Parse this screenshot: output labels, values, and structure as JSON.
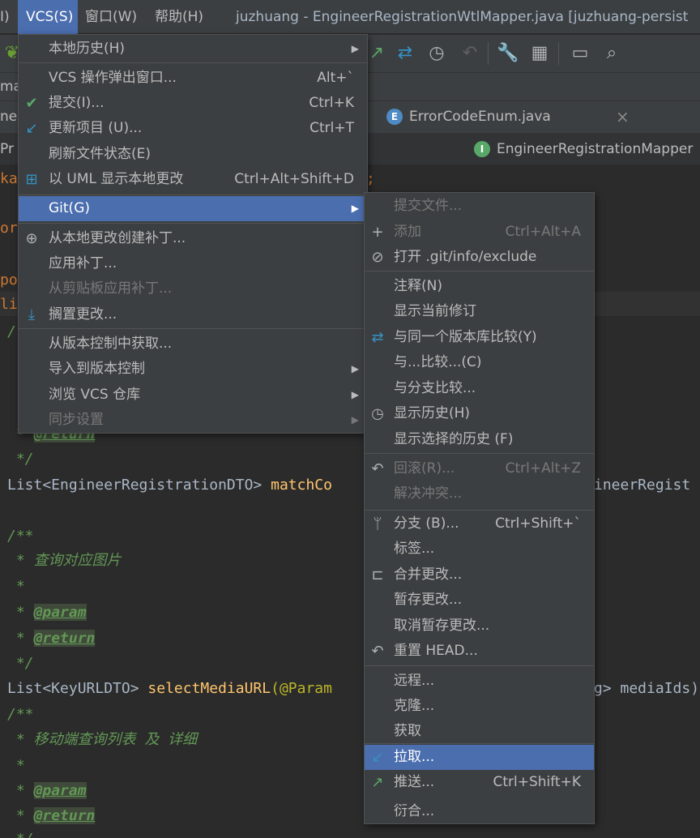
{
  "menubar": {
    "item_partial": "I)",
    "vcs": "VCS(S)",
    "window": "窗口(W)",
    "help": "帮助(H)",
    "title": "juzhuang - EngineerRegistrationWtlMapper.java [juzhuang-persist"
  },
  "navbar": {
    "crumb": "ma"
  },
  "tabs": {
    "left_partial": "ne",
    "active": "ErrorCodeEnum.java",
    "close": "×",
    "active_badge": "E"
  },
  "breadcrumb": {
    "left_partial": "Pr",
    "right": "EngineerRegistrationMapper",
    "right_badge": "I"
  },
  "code": {
    "l1": "ka",
    "l1b": ";",
    "l2": "or",
    "l3": "po",
    "l4": "li",
    "l5": "/",
    "l6": " * ",
    "l6tag": "@return",
    "l7": " */",
    "l8a": "List<EngineerRegistrationDTO> ",
    "l8b": "matchCo",
    "l8c": "ineerRegist",
    "l9": "/**",
    "l10": " * 查询对应图片",
    "l11": " *",
    "l12tag": "@param",
    "l13tag": "@return",
    "l14": " */",
    "l15a": "List<KeyURLDTO> ",
    "l15b": "selectMediaURL",
    "l15c": "(@Param",
    "l15d": "g> mediaIds)",
    "l16": "/**",
    "l17": " * 移动端查询列表 及 详细",
    "l18": " *",
    "l19tag": "@param",
    "l20tag": "@return",
    "l21": " */"
  },
  "vcs_menu": [
    {
      "label": "本地历史(H)",
      "arrow": "▶"
    },
    {
      "label": "VCS 操作弹出窗口...",
      "shortcut": "Alt+`"
    },
    {
      "label": "提交(I)...",
      "shortcut": "Ctrl+K",
      "icon": "✔"
    },
    {
      "label": "更新项目 (U)...",
      "shortcut": "Ctrl+T",
      "icon": "↙"
    },
    {
      "label": "刷新文件状态(E)"
    },
    {
      "label": "以 UML 显示本地更改",
      "shortcut": "Ctrl+Alt+Shift+D",
      "icon": "⊞"
    },
    {
      "label": "Git(G)",
      "arrow": "▶"
    },
    {
      "label": "从本地更改创建补丁...",
      "icon": "⊕"
    },
    {
      "label": "应用补丁..."
    },
    {
      "label": "从剪贴板应用补丁..."
    },
    {
      "label": "搁置更改...",
      "icon": "⤓"
    },
    {
      "label": "从版本控制中获取..."
    },
    {
      "label": "导入到版本控制",
      "arrow": "▶"
    },
    {
      "label": "浏览 VCS 仓库",
      "arrow": "▶"
    },
    {
      "label": "同步设置",
      "arrow": "▶"
    }
  ],
  "git_menu": [
    {
      "label": "提交文件..."
    },
    {
      "label": "添加",
      "shortcut": "Ctrl+Alt+A",
      "icon": "+"
    },
    {
      "label": "打开 .git/info/exclude",
      "icon": "⊘"
    },
    {
      "label": "注释(N)"
    },
    {
      "label": "显示当前修订"
    },
    {
      "label": "与同一个版本库比较(Y)",
      "icon": "⇄"
    },
    {
      "label": "与...比较...(C)"
    },
    {
      "label": "与分支比较..."
    },
    {
      "label": "显示历史(H)",
      "icon": "◷"
    },
    {
      "label": "显示选择的历史 (F)"
    },
    {
      "label": "回滚(R)...",
      "shortcut": "Ctrl+Alt+Z",
      "icon": "↶"
    },
    {
      "label": "解决冲突..."
    },
    {
      "label": "分支 (B)...",
      "shortcut": "Ctrl+Shift+`",
      "icon": "ᛘ"
    },
    {
      "label": "标签..."
    },
    {
      "label": "合并更改...",
      "icon": "⊏"
    },
    {
      "label": "暂存更改..."
    },
    {
      "label": "取消暂存更改..."
    },
    {
      "label": "重置 HEAD...",
      "icon": "↶"
    },
    {
      "label": "远程..."
    },
    {
      "label": "克隆..."
    },
    {
      "label": "获取"
    },
    {
      "label": "拉取...",
      "icon": "↙"
    },
    {
      "label": "推送...",
      "shortcut": "Ctrl+Shift+K",
      "icon": "↗"
    },
    {
      "label": "衍合..."
    }
  ],
  "toolbar_icons": {
    "push": "↗",
    "compare": "⇄",
    "history": "◷",
    "rollback": "↶",
    "settings": "🔧",
    "structure": "▦",
    "terminal": "▭",
    "search": "⌕",
    "leaf": "❦"
  }
}
